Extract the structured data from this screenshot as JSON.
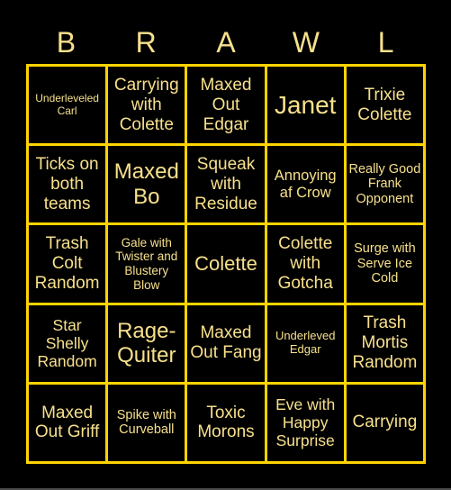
{
  "header": [
    "B",
    "R",
    "A",
    "W",
    "L"
  ],
  "colors": {
    "background": "#000000",
    "border": "#FFD400",
    "text": "#F7E08C"
  },
  "cells": [
    [
      "Underleveled Carl",
      "Carrying with Colette",
      "Maxed Out Edgar",
      "Janet",
      "Trixie Colette"
    ],
    [
      "Ticks on both teams",
      "Maxed Bo",
      "Squeak with Residue",
      "Annoying af Crow",
      "Really Good Frank Opponent"
    ],
    [
      "Trash Colt Random",
      "Gale with Twister and Blustery Blow",
      "Colette",
      "Colette with Gotcha",
      "Surge with Serve Ice Cold"
    ],
    [
      "Star Shelly Random",
      "Rage-Quiter",
      "Maxed Out Fang",
      "Underleved Edgar",
      "Trash Mortis Random"
    ],
    [
      "Maxed Out Griff",
      "Spike with Curveball",
      "Toxic Morons",
      "Eve with Happy Surprise",
      "Carrying"
    ]
  ]
}
